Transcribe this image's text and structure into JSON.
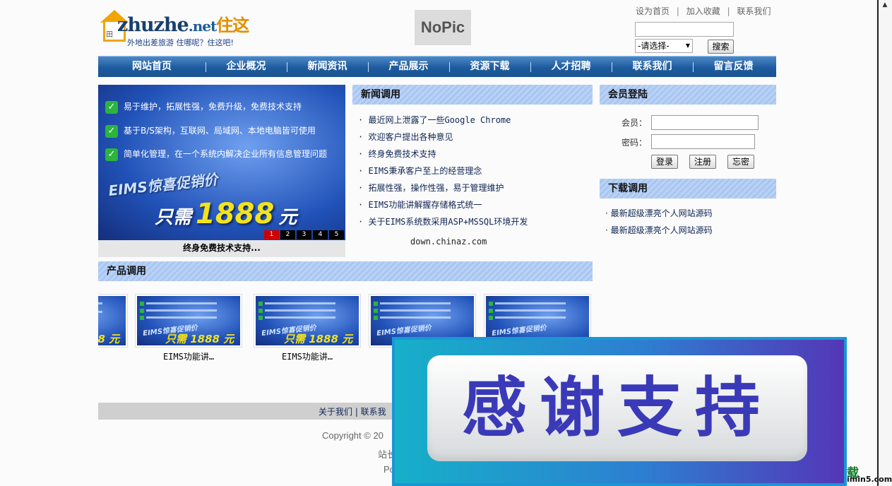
{
  "logo": {
    "brand": "zhuzhe",
    "brand_net": ".net",
    "brand_cn": "住这",
    "slogan": "外地出差旅游 住哪呢？住这吧!"
  },
  "nopic": "NoPic",
  "toplinks": [
    "设为首页",
    "加入收藏",
    "联系我们"
  ],
  "toplinks_sep": "|",
  "search": {
    "input_value": "",
    "select_value": "-请选择-",
    "button": "搜索"
  },
  "nav": [
    "网站首页",
    "企业概况",
    "新闻资讯",
    "产品展示",
    "资源下载",
    "人才招聘",
    "联系我们",
    "留言反馈"
  ],
  "banner": {
    "lines": [
      "易于维护，拓展性强，免费升级，免费技术支持",
      "基于B/S架构，互联网、局域网、本地电脑皆可使用",
      "简单化管理，在一个系统内解决企业所有信息管理问题"
    ],
    "promo": "EIMS惊喜促销价",
    "price_prefix": "只需",
    "price_num": "1888",
    "price_unit": "元",
    "pages": [
      "1",
      "2",
      "3",
      "4",
      "5"
    ],
    "caption": "终身免费技术支持..."
  },
  "news": {
    "title": "新闻调用",
    "items": [
      "最近网上泄露了一些Google Chrome",
      "欢迎客户提出各种意见",
      "终身免费技术支持",
      "EIMS秉承客户至上的经营理念",
      "拓展性强，操作性强，易于管理维护",
      "EIMS功能讲解握存储格式统一",
      "关于EIMS系统数采用ASP+MSSQL环境开发"
    ],
    "footer": "down.chinaz.com"
  },
  "member": {
    "title": "会员登陆",
    "user_label": "会员：",
    "pass_label": "密码：",
    "login": "登录",
    "register": "注册",
    "forgot": "忘密"
  },
  "downloads": {
    "title": "下载调用",
    "items": [
      "最新超级漂亮个人网站源码",
      "最新超级漂亮个人网站源码"
    ]
  },
  "products": {
    "title": "产品调用",
    "captions": [
      "EIMS功能讲…",
      "EIMS功能讲…"
    ],
    "thumb_price": "只需 1888 元",
    "thumb_promo": "EIMS惊喜促销价"
  },
  "footer": {
    "links": "关于我们 | 联系我",
    "copy1": "Copyright © 20",
    "copy2": "站长",
    "copy3": "Po"
  },
  "overlay": {
    "text": "感谢支持"
  },
  "watermark": {
    "line1": "载",
    "line2": "imin5.com"
  }
}
